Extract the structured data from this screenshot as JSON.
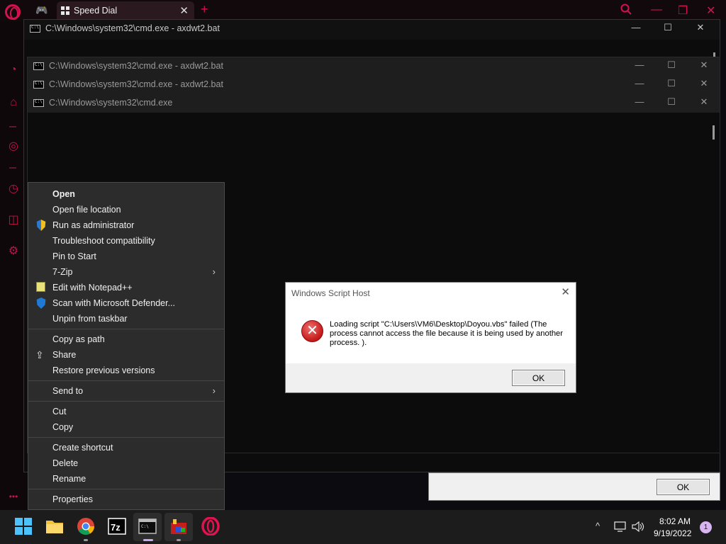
{
  "browser": {
    "tab_title": "Speed Dial",
    "tab_close": "✕",
    "new_tab": "+",
    "search_icon": "search-icon",
    "minimize_glyph": "—",
    "restore_glyph": "❐",
    "close_glyph": "✕"
  },
  "sidebar": {
    "dots": "•••"
  },
  "windows": [
    {
      "title": "C:\\Windows\\system32\\cmd.exe - axdwt2.bat"
    },
    {
      "title": "C:\\Windows\\system32\\cmd.exe - axdwt2.bat"
    },
    {
      "title": "C:\\Windows\\system32\\cmd.exe - axdwt2.bat"
    },
    {
      "title": "C:\\Windows\\system32\\cmd.exe"
    }
  ],
  "window_controls": {
    "minimize": "—",
    "maximize": "☐",
    "close": "✕"
  },
  "context_menu": {
    "items": [
      {
        "label": "Open"
      },
      {
        "label": "Open file location"
      },
      {
        "label": "Run as administrator"
      },
      {
        "label": "Troubleshoot compatibility"
      },
      {
        "label": "Pin to Start"
      },
      {
        "label": "7-Zip"
      },
      {
        "label": "Edit with Notepad++"
      },
      {
        "label": "Scan with Microsoft Defender..."
      },
      {
        "label": "Unpin from taskbar"
      },
      {
        "label": "Copy as path"
      },
      {
        "label": "Share"
      },
      {
        "label": "Restore previous versions"
      },
      {
        "label": "Send to"
      },
      {
        "label": "Cut"
      },
      {
        "label": "Copy"
      },
      {
        "label": "Create shortcut"
      },
      {
        "label": "Delete"
      },
      {
        "label": "Rename"
      },
      {
        "label": "Properties"
      }
    ],
    "submenu_arrow": "›"
  },
  "dialog": {
    "title": "Windows Script Host",
    "close": "✕",
    "icon": "error-icon",
    "message": "Loading script \"C:\\Users\\VM6\\Desktop\\Doyou.vbs\" failed (The process cannot access the file because it is being used by another process. ).",
    "ok_label": "OK"
  },
  "second_dialog": {
    "ok_label": "OK"
  },
  "taskbar": {
    "apps": [
      "windows-start-icon",
      "file-explorer-icon",
      "chrome-icon",
      "7zip-icon",
      "terminal-icon",
      "script-app-icon",
      "opera-icon"
    ],
    "tray_chevron": "^",
    "time": "8:02 AM",
    "date": "9/19/2022",
    "notification_count": "1"
  },
  "colors": {
    "opera_accent": "#d5124f",
    "error_red": "#c41818",
    "taskbar_bg": "#1c1c1c"
  }
}
